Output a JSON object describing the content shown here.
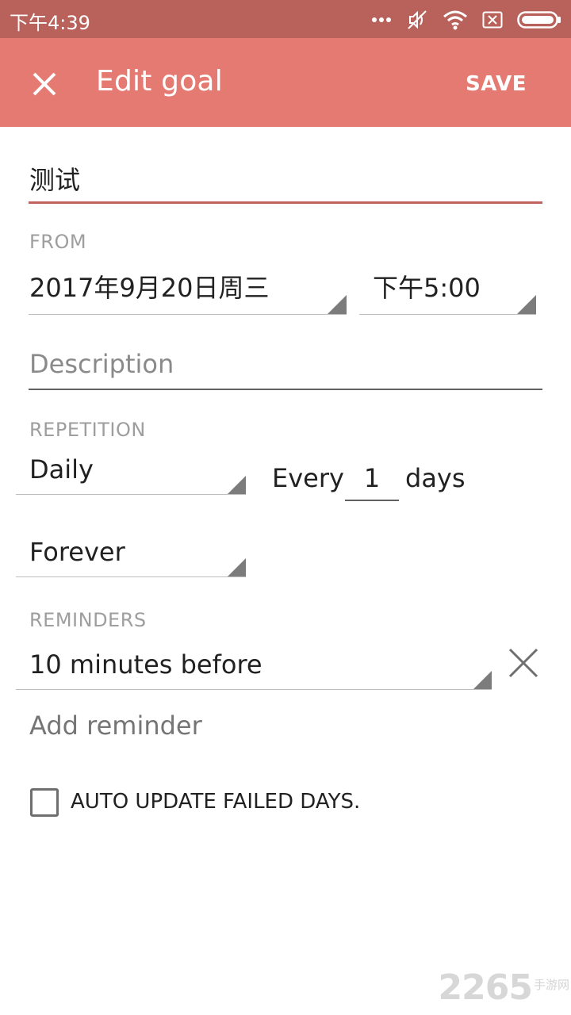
{
  "status_bar": {
    "time": "下午4:39",
    "icons": [
      "more-dots-icon",
      "mute-icon",
      "wifi-icon",
      "sim-off-icon",
      "battery-icon"
    ]
  },
  "app_bar": {
    "title": "Edit goal",
    "save_label": "SAVE",
    "close_icon": "close-icon",
    "color": "#e57a72"
  },
  "form": {
    "title_value": "测试",
    "from_label": "FROM",
    "from_date": "2017年9月20日周三",
    "from_time": "下午5:00",
    "description_placeholder": "Description",
    "repetition_label": "REPETITION",
    "repetition_mode": "Daily",
    "every_label": "Every",
    "every_value": "1",
    "every_unit": "days",
    "duration_mode": "Forever",
    "reminders_label": "REMINDERS",
    "reminder_item": "10 minutes before",
    "add_reminder_label": "Add reminder",
    "auto_update_label": "AUTO UPDATE FAILED DAYS.",
    "auto_update_checked": false
  },
  "watermark": {
    "number": "2265",
    "text": "手游网"
  }
}
